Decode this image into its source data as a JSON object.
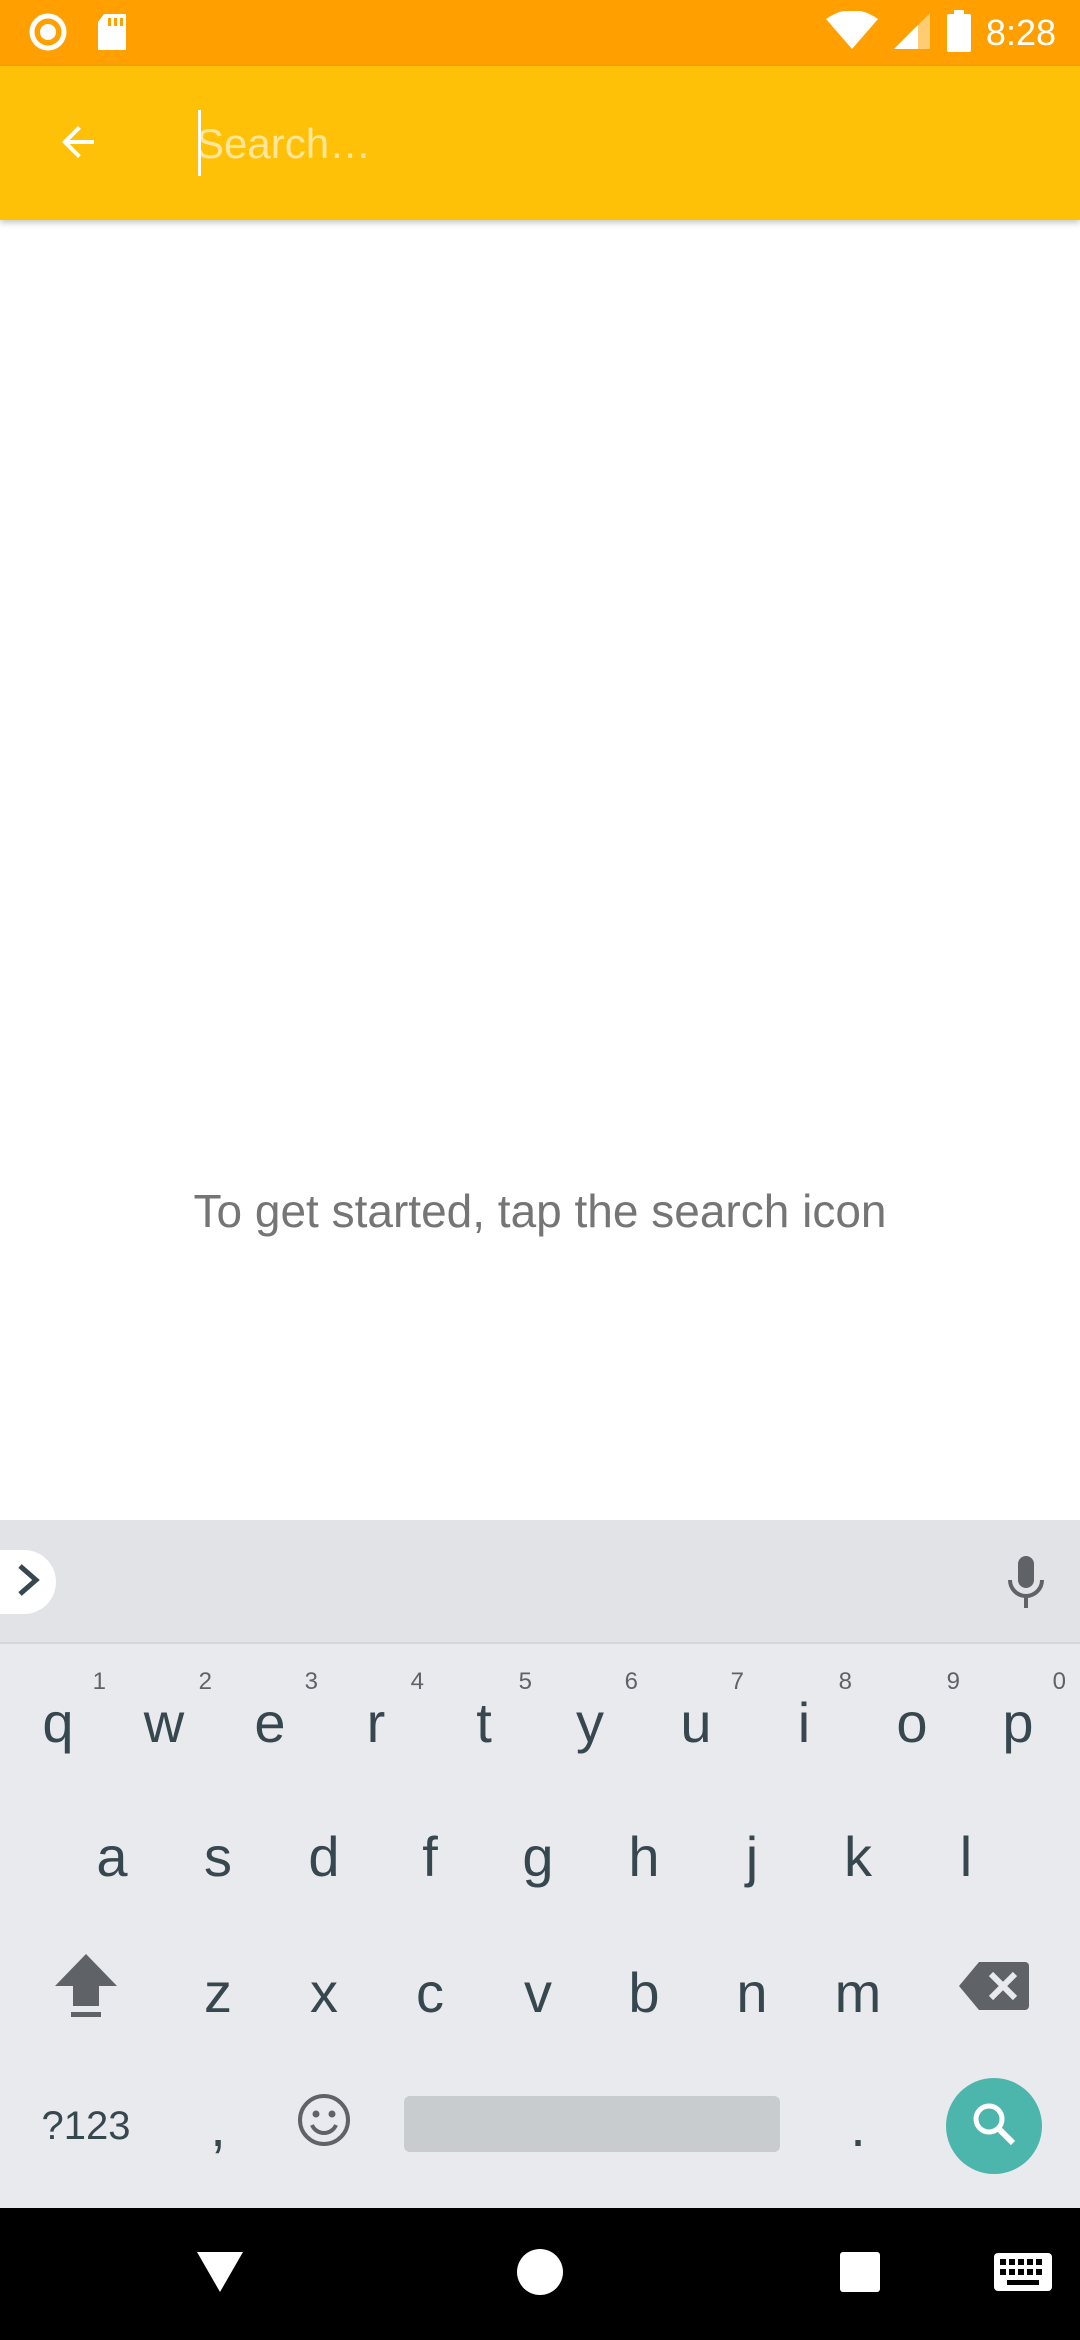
{
  "status_bar": {
    "time": "8:28"
  },
  "search": {
    "placeholder": "Search…",
    "value": ""
  },
  "empty_state": {
    "hint": "To get started, tap the search icon"
  },
  "keyboard": {
    "row1": [
      {
        "k": "q",
        "n": "1"
      },
      {
        "k": "w",
        "n": "2"
      },
      {
        "k": "e",
        "n": "3"
      },
      {
        "k": "r",
        "n": "4"
      },
      {
        "k": "t",
        "n": "5"
      },
      {
        "k": "y",
        "n": "6"
      },
      {
        "k": "u",
        "n": "7"
      },
      {
        "k": "i",
        "n": "8"
      },
      {
        "k": "o",
        "n": "9"
      },
      {
        "k": "p",
        "n": "0"
      }
    ],
    "row2": [
      "a",
      "s",
      "d",
      "f",
      "g",
      "h",
      "j",
      "k",
      "l"
    ],
    "row3": [
      "z",
      "x",
      "c",
      "v",
      "b",
      "n",
      "m"
    ],
    "symbols_label": "?123",
    "comma_label": ",",
    "period_label": "."
  },
  "colors": {
    "status_bar": "#FFA000",
    "app_bar": "#FFC107",
    "search_key": "#4DB6AC"
  },
  "icons": [
    "back-arrow-icon",
    "mic-icon",
    "chevron-right-icon",
    "shift-icon",
    "backspace-icon",
    "emoji-icon",
    "search-icon",
    "nav-back-icon",
    "nav-home-icon",
    "nav-recents-icon",
    "keyboard-icon"
  ]
}
